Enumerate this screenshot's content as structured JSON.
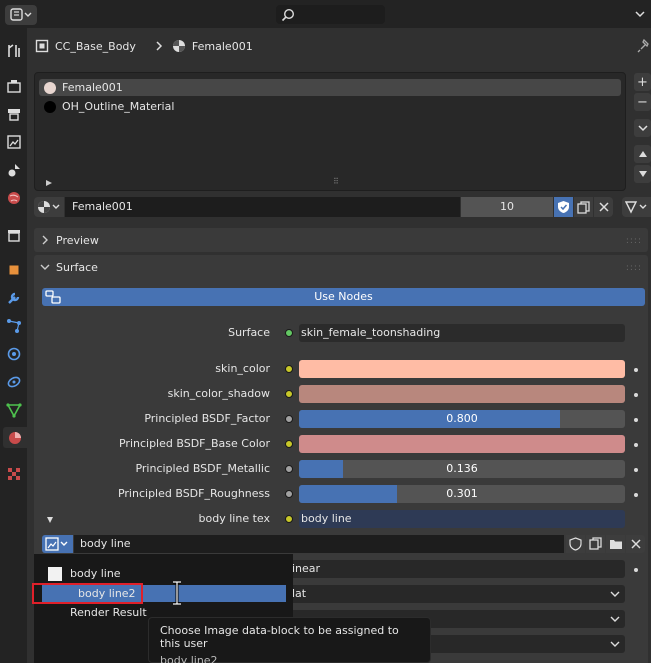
{
  "breadcrumb": {
    "object": "CC_Base_Body",
    "material": "Female001"
  },
  "material_slots": [
    {
      "name": "Female001",
      "active": true
    },
    {
      "name": "OH_Outline_Material",
      "active": false
    }
  ],
  "material_selector": {
    "name": "Female001",
    "users": "10"
  },
  "panels": {
    "preview": "Preview",
    "surface": "Surface"
  },
  "surface": {
    "use_nodes_label": "Use Nodes",
    "surface_label": "Surface",
    "surface_value": "skin_female_toonshading",
    "props": [
      {
        "label": "skin_color",
        "type": "color",
        "color": "#ffbca5",
        "socket": "yellow"
      },
      {
        "label": "skin_color_shadow",
        "type": "color",
        "color": "#b8877d",
        "socket": "yellow"
      },
      {
        "label": "Principled BSDF_Factor",
        "type": "slider",
        "value": "0.800",
        "fraction": 0.8,
        "socket": "grey"
      },
      {
        "label": "Principled BSDF_Base Color",
        "type": "color",
        "color": "#cf8b8b",
        "socket": "yellow"
      },
      {
        "label": "Principled BSDF_Metallic",
        "type": "slider",
        "value": "0.136",
        "fraction": 0.136,
        "socket": "grey"
      },
      {
        "label": "Principled BSDF_Roughness",
        "type": "slider",
        "value": "0.301",
        "fraction": 0.301,
        "socket": "grey"
      }
    ],
    "body_line_tex_label": "body line tex",
    "body_line_tex_value": "body line"
  },
  "image_datablock": {
    "name": "body line"
  },
  "dropdowns": [
    "inear",
    "lat",
    "",
    ""
  ],
  "popup_items": [
    {
      "label": "body line",
      "highlighted": false
    },
    {
      "label": "body line2",
      "highlighted": true
    },
    {
      "label": "Render Result",
      "highlighted": false
    }
  ],
  "tooltip": {
    "line1": "Choose Image data-block to be assigned to this user",
    "line2": "body line2"
  },
  "colors": {
    "accent": "#4772b3",
    "background": "#303030"
  }
}
